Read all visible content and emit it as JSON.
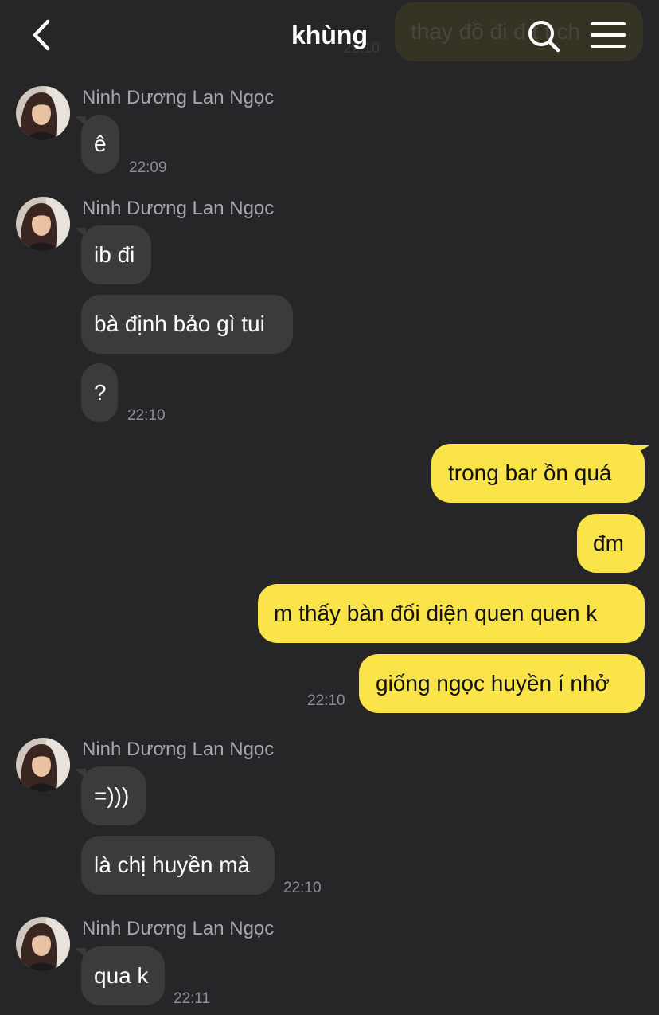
{
  "header": {
    "title": "khùng",
    "back_icon": "chevron-left-icon",
    "search_icon": "search-icon",
    "menu_icon": "hamburger-menu-icon"
  },
  "ghost": {
    "text": "thay đồ đi đ t t ch",
    "time": "22:10"
  },
  "colors": {
    "background": "#262628",
    "incoming_bubble": "#3b3b3e",
    "outgoing_bubble": "#fbe34a",
    "timestamp": "#8e8e93",
    "sender_name": "#a7a7ab"
  },
  "messages": {
    "g1": {
      "sender": "Ninh Dương Lan Ngọc",
      "m1": "ê",
      "time": "22:09"
    },
    "g2": {
      "sender": "Ninh Dương Lan Ngọc",
      "m1": "ib đi",
      "m2": "bà định bảo gì tui",
      "m3": "?",
      "time": "22:10"
    },
    "g3": {
      "m1": "trong bar ồn quá",
      "m2": "đm",
      "m3": "m thấy bàn đối diện quen quen k",
      "m4": "giống ngọc huyền í nhở",
      "time": "22:10"
    },
    "g4": {
      "sender": "Ninh Dương Lan Ngọc",
      "m1": "=)))",
      "m2": "là chị huyền mà",
      "time": "22:10"
    },
    "g5": {
      "sender": "Ninh Dương Lan Ngọc",
      "m1": "qua k",
      "time": "22:11"
    }
  }
}
